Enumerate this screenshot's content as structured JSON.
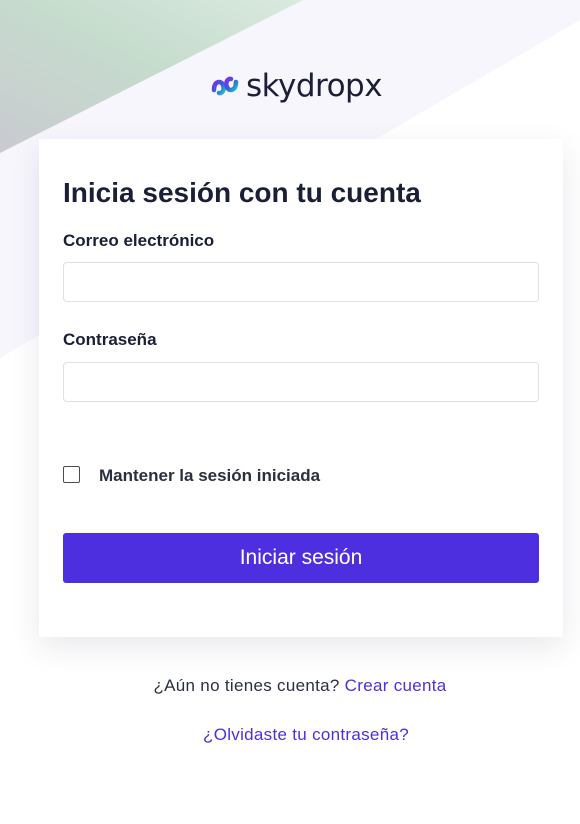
{
  "brand": {
    "name": "skydropx",
    "logo_icon": "skydropx-s-mark-icon"
  },
  "login": {
    "title": "Inicia sesión con tu cuenta",
    "email_label": "Correo electrónico",
    "email_value": "",
    "password_label": "Contraseña",
    "password_value": "",
    "remember_label": "Mantener la sesión iniciada",
    "remember_checked": false,
    "submit_label": "Iniciar sesión"
  },
  "footer": {
    "no_account_text": "¿Aún no tienes cuenta?",
    "create_account_link": "Crear cuenta",
    "forgot_password_link": "¿Olvidaste tu contraseña?"
  },
  "colors": {
    "accent": "#4d2fe0",
    "text": "#1a1f36",
    "background": "#ffffff"
  }
}
